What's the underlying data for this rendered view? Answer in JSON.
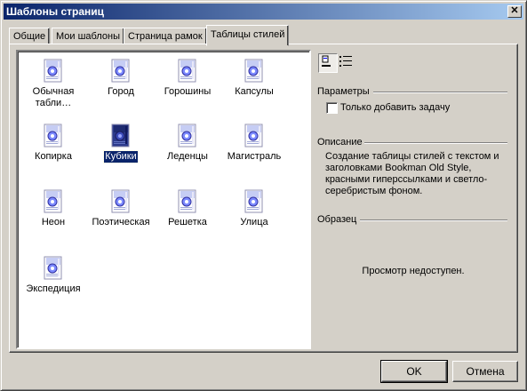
{
  "window": {
    "title": "Шаблоны страниц",
    "close_label": "✕"
  },
  "tabs": [
    {
      "label": "Общие"
    },
    {
      "label": "Мои шаблоны"
    },
    {
      "label": "Страница рамок"
    },
    {
      "label": "Таблицы стилей",
      "active": true
    }
  ],
  "templates": [
    {
      "label": "Обычная табли…"
    },
    {
      "label": "Город"
    },
    {
      "label": "Горошины"
    },
    {
      "label": "Капсулы"
    },
    {
      "label": "Копирка"
    },
    {
      "label": "Кубики",
      "selected": true
    },
    {
      "label": "Леденцы"
    },
    {
      "label": "Магистраль"
    },
    {
      "label": "Неон"
    },
    {
      "label": "Поэтическая"
    },
    {
      "label": "Решетка"
    },
    {
      "label": "Улица"
    },
    {
      "label": "Экспедиция"
    }
  ],
  "view_buttons": {
    "large_icons": "large-icons-view",
    "details": "details-view"
  },
  "parameters": {
    "label": "Параметры",
    "checkbox_label": "Только добавить задачу",
    "checked": false
  },
  "description": {
    "label": "Описание",
    "text": "Создание таблицы стилей с текстом и заголовками Bookman Old Style, красными гиперссылками и светло-серебристым фоном."
  },
  "sample": {
    "label": "Образец",
    "preview_text": "Просмотр недоступен."
  },
  "buttons": {
    "ok": "OK",
    "cancel": "Отмена"
  }
}
